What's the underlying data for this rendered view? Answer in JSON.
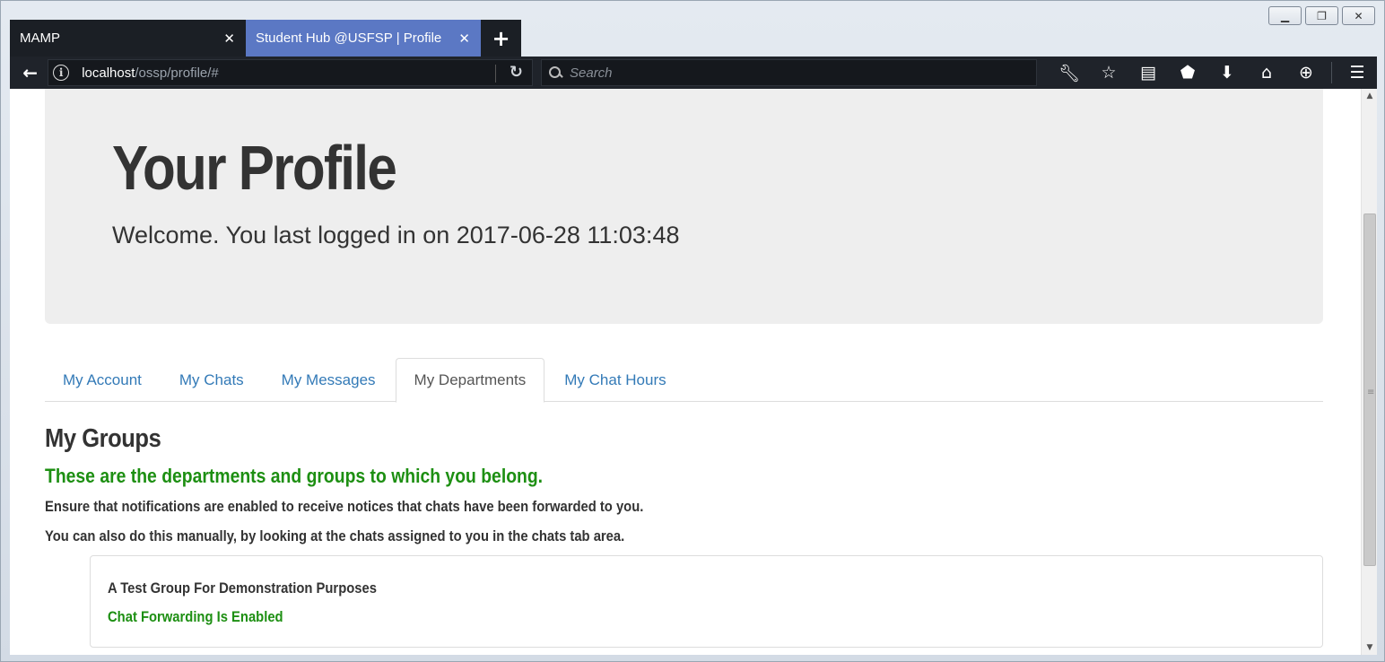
{
  "window": {
    "controls": {
      "minimize": "▁",
      "restore": "❐",
      "close": "✕"
    }
  },
  "tabs": [
    {
      "title": "MAMP",
      "close": "✕",
      "active": false
    },
    {
      "title": "Student Hub @USFSP | Profile",
      "close": "✕",
      "active": true
    }
  ],
  "new_tab_label": "+",
  "navbar": {
    "back_icon": "back-arrow",
    "url_host": "localhost",
    "url_path": "/ossp/profile/#",
    "search_placeholder": "Search",
    "icons": [
      "wrench-icon",
      "star-icon",
      "reader-icon",
      "pocket-icon",
      "download-icon",
      "home-icon",
      "globe-icon",
      "menu-icon"
    ]
  },
  "page": {
    "title": "Your Profile",
    "welcome": "Welcome. You last logged in on 2017-06-28 11:03:48",
    "profile_tabs": [
      {
        "label": "My Account",
        "active": false
      },
      {
        "label": "My Chats",
        "active": false
      },
      {
        "label": "My Messages",
        "active": false
      },
      {
        "label": "My Departments",
        "active": true
      },
      {
        "label": "My Chat Hours",
        "active": false
      }
    ],
    "section_title": "My Groups",
    "section_subtitle": "These are the departments and groups to which you belong.",
    "note_1": "Ensure that notifications are enabled to receive notices that chats have been forwarded to you.",
    "note_2": "You can also do this manually, by looking at the chats assigned to you in the chats tab area.",
    "groups": [
      {
        "name": "A Test Group For Demonstration Purposes",
        "status": "Chat Forwarding Is Enabled"
      }
    ]
  },
  "colors": {
    "accent_link": "#337ab7",
    "success_green": "#1d8f12",
    "active_tab": "#5b78c4",
    "toolbar_dark": "#1f232a"
  }
}
